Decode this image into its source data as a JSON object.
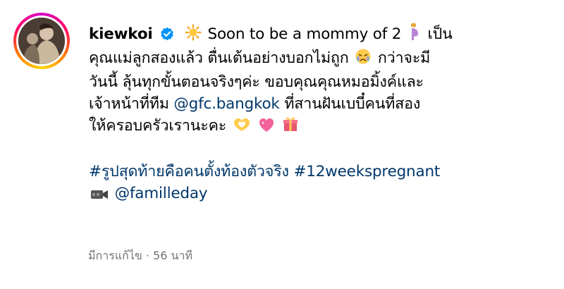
{
  "post": {
    "username": "kiewkoi",
    "line1_text": "Soon to be a mommy of 2",
    "line1_end": "เป็น",
    "line2_text": "คุณแม่ลูกสองแล้ว ตื่นเต้นอย่างบอกไม่ถูก",
    "line2_end": "กว่าจะมี",
    "line3_text": "วันนี้ ลุ้นทุกขั้นตอนจริงๆค่ะ ขอบคุณคุณหมอมิ้งค์และ",
    "line4_text": "เจ้าหน้าที่ทีม",
    "mention_gfc": "@gfc.bangkok",
    "line4_end": "ที่สานฝันเบบี๋คนที่สอง",
    "line5_text": "ให้ครอบครัวเรานะคะ",
    "hashtag1": "#รูปสุดท้ายคือคนตั้งท้องตัวจริง",
    "hashtag2": "#12weekspregnant",
    "mention_famille": "@familleday",
    "meta_text": "มีการแก้ไข · 56 นาที"
  },
  "icons": {
    "verified": "verified-badge-icon",
    "sun": "sun-emoji-icon",
    "pregnant": "pregnant-woman-emoji-icon",
    "crying": "crying-face-emoji-icon",
    "heart_hands": "heart-hands-emoji-icon",
    "sparkling_heart": "sparkling-heart-emoji-icon",
    "gift": "gift-emoji-icon",
    "camera": "video-camera-emoji-icon"
  },
  "colors": {
    "link": "#00376b",
    "verified": "#0095f6",
    "meta": "#737373",
    "text": "#000000"
  }
}
